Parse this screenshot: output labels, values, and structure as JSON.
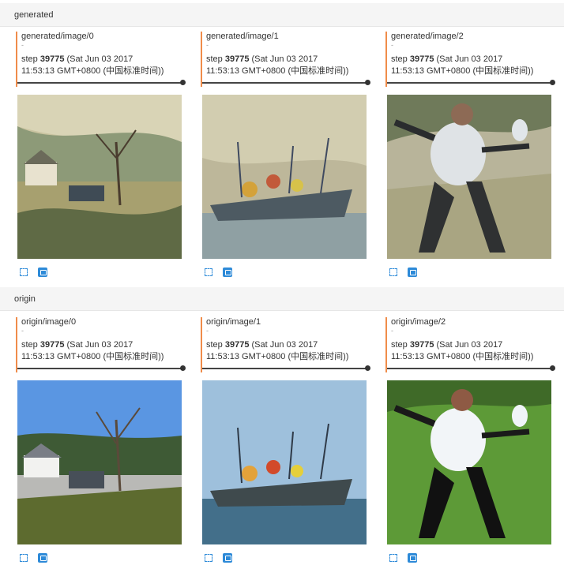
{
  "groups": [
    {
      "title": "generated",
      "cards": [
        {
          "tag": "generated/image/0",
          "dot": "-",
          "step_label": "step",
          "step_value": "39775",
          "date_line1": "(Sat Jun 03 2017",
          "date_line2": "11:53:13 GMT+0800 (中国标准时间))"
        },
        {
          "tag": "generated/image/1",
          "dot": "-",
          "step_label": "step",
          "step_value": "39775",
          "date_line1": "(Sat Jun 03 2017",
          "date_line2": "11:53:13 GMT+0800 (中国标准时间))"
        },
        {
          "tag": "generated/image/2",
          "dot": "-",
          "step_label": "step",
          "step_value": "39775",
          "date_line1": "(Sat Jun 03 2017",
          "date_line2": "11:53:13 GMT+0800 (中国标准时间))"
        }
      ]
    },
    {
      "title": "origin",
      "cards": [
        {
          "tag": "origin/image/0",
          "dot": "-",
          "step_label": "step",
          "step_value": "39775",
          "date_line1": "(Sat Jun 03 2017",
          "date_line2": "11:53:13 GMT+0800 (中国标准时间))"
        },
        {
          "tag": "origin/image/1",
          "dot": "-",
          "step_label": "step",
          "step_value": "39775",
          "date_line1": "(Sat Jun 03 2017",
          "date_line2": "11:53:13 GMT+0800 (中国标准时间))"
        },
        {
          "tag": "origin/image/2",
          "dot": "-",
          "step_label": "step",
          "step_value": "39775",
          "date_line1": "(Sat Jun 03 2017",
          "date_line2": "11:53:13 GMT+0800 (中国标准时间))"
        }
      ]
    }
  ],
  "icons": {
    "fit": "fit-to-screen-icon",
    "open": "open-image-icon"
  },
  "colors": {
    "accent_border": "#f08c4a",
    "icon_blue": "#2d8ad8"
  }
}
